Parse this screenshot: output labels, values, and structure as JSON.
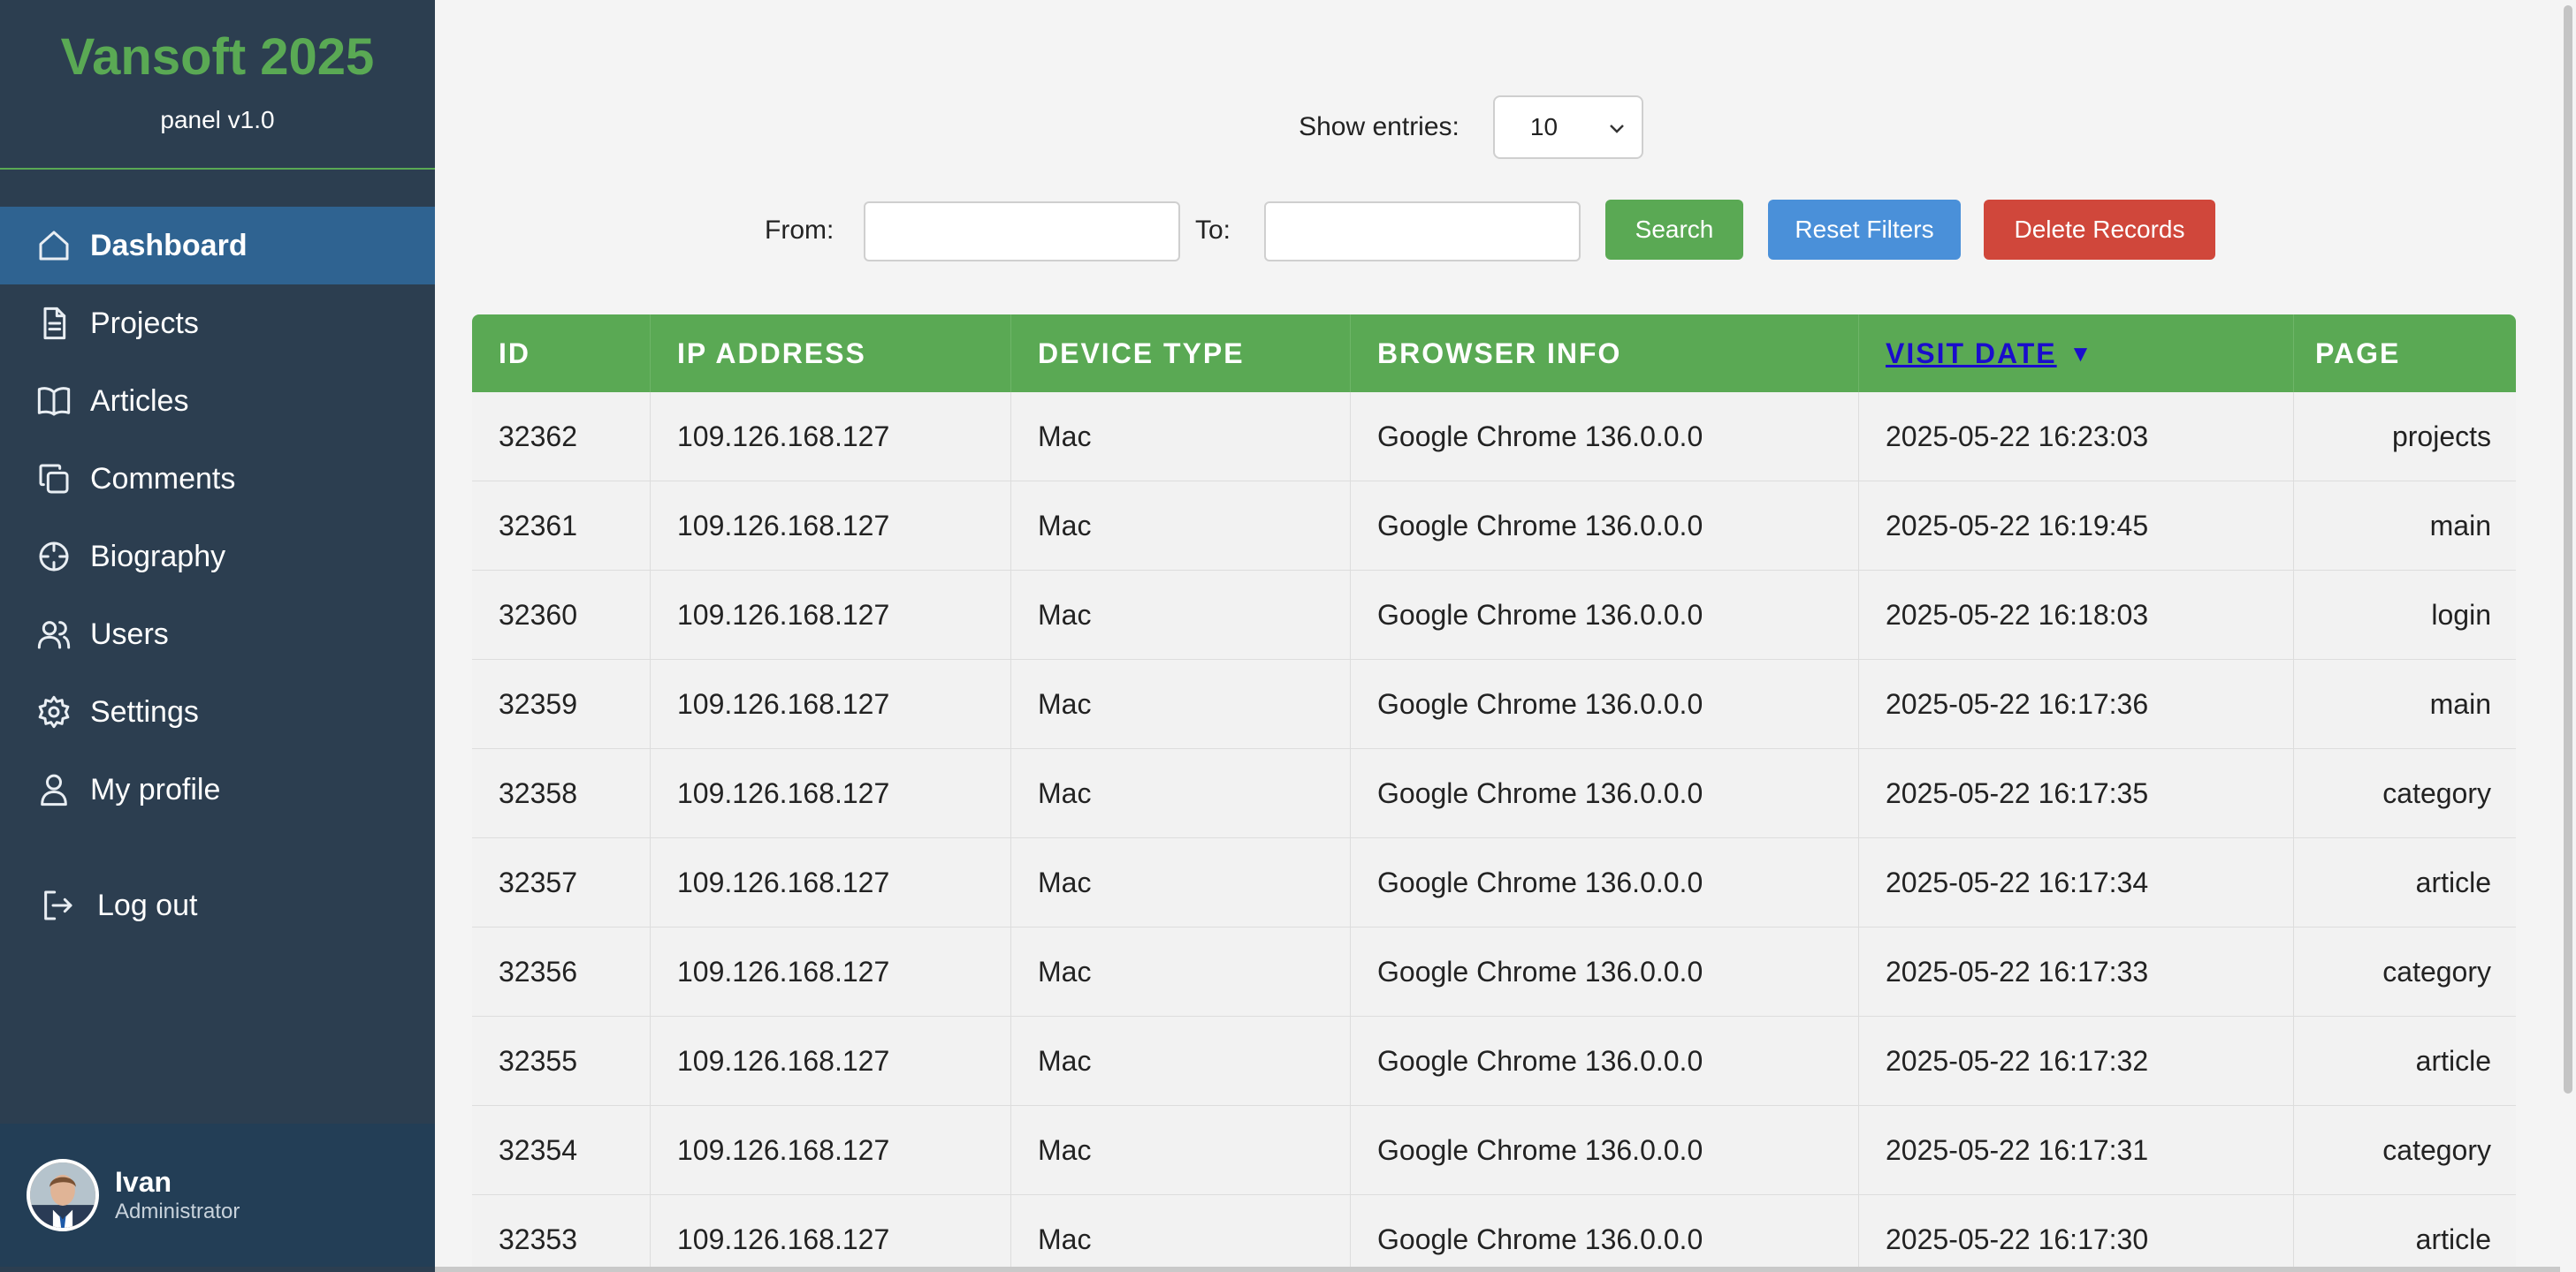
{
  "brand": {
    "title": "Vansoft 2025",
    "subtitle": "panel v1.0"
  },
  "sidebar": {
    "items": [
      {
        "label": "Dashboard",
        "icon": "home-icon",
        "active": true
      },
      {
        "label": "Projects",
        "icon": "document-icon"
      },
      {
        "label": "Articles",
        "icon": "book-icon"
      },
      {
        "label": "Comments",
        "icon": "copy-icon"
      },
      {
        "label": "Biography",
        "icon": "crosshair-icon"
      },
      {
        "label": "Users",
        "icon": "users-icon"
      },
      {
        "label": "Settings",
        "icon": "gear-icon"
      },
      {
        "label": "My profile",
        "icon": "user-icon"
      }
    ],
    "logout": {
      "label": "Log out",
      "icon": "logout-icon"
    }
  },
  "user": {
    "name": "Ivan",
    "role": "Administrator"
  },
  "controls": {
    "show_entries_label": "Show entries:",
    "show_entries_value": "10",
    "from_label": "From:",
    "to_label": "To:",
    "from_value": "",
    "to_value": "",
    "search_label": "Search",
    "reset_label": "Reset Filters",
    "delete_label": "Delete Records"
  },
  "table": {
    "headers": [
      "ID",
      "IP ADDRESS",
      "DEVICE TYPE",
      "BROWSER INFO",
      "VISIT DATE",
      "PAGE"
    ],
    "sort_indicator": "▼",
    "rows": [
      [
        "32362",
        "109.126.168.127",
        "Mac",
        "Google Chrome 136.0.0.0",
        "2025-05-22 16:23:03",
        "projects"
      ],
      [
        "32361",
        "109.126.168.127",
        "Mac",
        "Google Chrome 136.0.0.0",
        "2025-05-22 16:19:45",
        "main"
      ],
      [
        "32360",
        "109.126.168.127",
        "Mac",
        "Google Chrome 136.0.0.0",
        "2025-05-22 16:18:03",
        "login"
      ],
      [
        "32359",
        "109.126.168.127",
        "Mac",
        "Google Chrome 136.0.0.0",
        "2025-05-22 16:17:36",
        "main"
      ],
      [
        "32358",
        "109.126.168.127",
        "Mac",
        "Google Chrome 136.0.0.0",
        "2025-05-22 16:17:35",
        "category"
      ],
      [
        "32357",
        "109.126.168.127",
        "Mac",
        "Google Chrome 136.0.0.0",
        "2025-05-22 16:17:34",
        "article"
      ],
      [
        "32356",
        "109.126.168.127",
        "Mac",
        "Google Chrome 136.0.0.0",
        "2025-05-22 16:17:33",
        "category"
      ],
      [
        "32355",
        "109.126.168.127",
        "Mac",
        "Google Chrome 136.0.0.0",
        "2025-05-22 16:17:32",
        "article"
      ],
      [
        "32354",
        "109.126.168.127",
        "Mac",
        "Google Chrome 136.0.0.0",
        "2025-05-22 16:17:31",
        "category"
      ],
      [
        "32353",
        "109.126.168.127",
        "Mac",
        "Google Chrome 136.0.0.0",
        "2025-05-22 16:17:30",
        "article"
      ]
    ]
  },
  "colors": {
    "sidebar_bg": "#2c3e50",
    "brand_green": "#5aa954",
    "active_item": "#2f6391",
    "search_button": "#5aa954",
    "reset_button": "#4a90d9",
    "delete_button": "#d0473b",
    "sorted_header_link": "#1a0dcc"
  }
}
